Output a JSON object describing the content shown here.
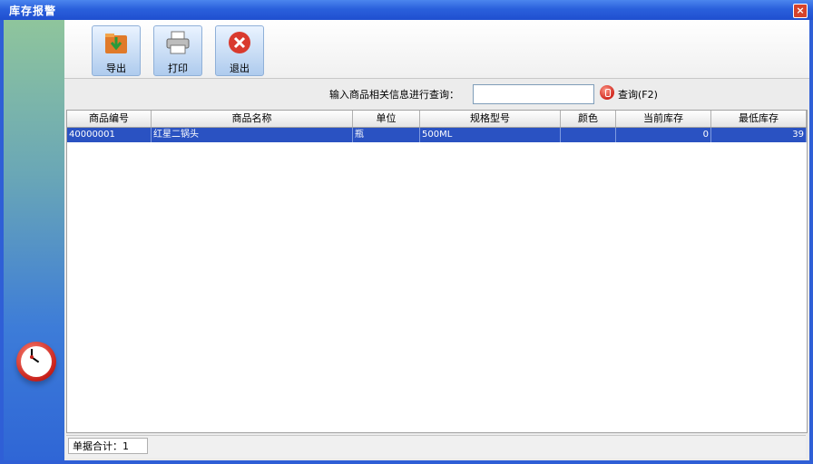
{
  "window": {
    "title": "库存报警",
    "close_label": "×"
  },
  "toolbar": {
    "export_label": "导出",
    "print_label": "打印",
    "exit_label": "退出"
  },
  "search": {
    "label": "输入商品相关信息进行查询：",
    "value": "",
    "button_label": "查询(F2)"
  },
  "table": {
    "columns": [
      "商品编号",
      "商品名称",
      "单位",
      "规格型号",
      "颜色",
      "当前库存",
      "最低库存"
    ],
    "rows": [
      [
        "40000001",
        "红星二锅头",
        "瓶",
        "500ML",
        "",
        "0",
        "39"
      ]
    ]
  },
  "footer": {
    "summary": "单据合计：1"
  },
  "colors": {
    "titlebar": "#2a60dc",
    "selected_row": "#2a52c2",
    "accent_red": "#d0281e"
  }
}
